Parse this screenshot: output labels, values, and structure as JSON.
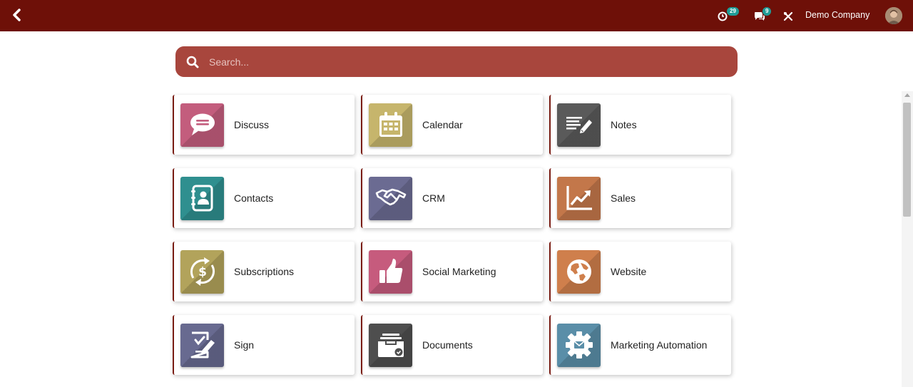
{
  "topbar": {
    "activity_count": "29",
    "messages_count": "9",
    "company_name": "Demo Company"
  },
  "search": {
    "placeholder": "Search..."
  },
  "apps": [
    {
      "label": "Discuss",
      "color": "#c35d7d",
      "icon": "chat-bubble-icon"
    },
    {
      "label": "Calendar",
      "color": "#c6b56c",
      "icon": "calendar-icon"
    },
    {
      "label": "Notes",
      "color": "#5a5a5a",
      "icon": "notes-pen-icon"
    },
    {
      "label": "Contacts",
      "color": "#2f8f8f",
      "icon": "address-book-icon"
    },
    {
      "label": "CRM",
      "color": "#6b6b92",
      "icon": "handshake-icon"
    },
    {
      "label": "Sales",
      "color": "#c3774a",
      "icon": "trend-chart-icon"
    },
    {
      "label": "Subscriptions",
      "color": "#b2a35b",
      "icon": "recurring-dollar-icon"
    },
    {
      "label": "Social Marketing",
      "color": "#c65b7d",
      "icon": "thumbs-up-icon"
    },
    {
      "label": "Website",
      "color": "#cf7f4c",
      "icon": "globe-icon"
    },
    {
      "label": "Sign",
      "color": "#686a90",
      "icon": "signed-document-icon"
    },
    {
      "label": "Documents",
      "color": "#4e4e4e",
      "icon": "document-tray-icon"
    },
    {
      "label": "Marketing Automation",
      "color": "#5a8ea8",
      "icon": "gear-envelope-icon"
    }
  ]
}
